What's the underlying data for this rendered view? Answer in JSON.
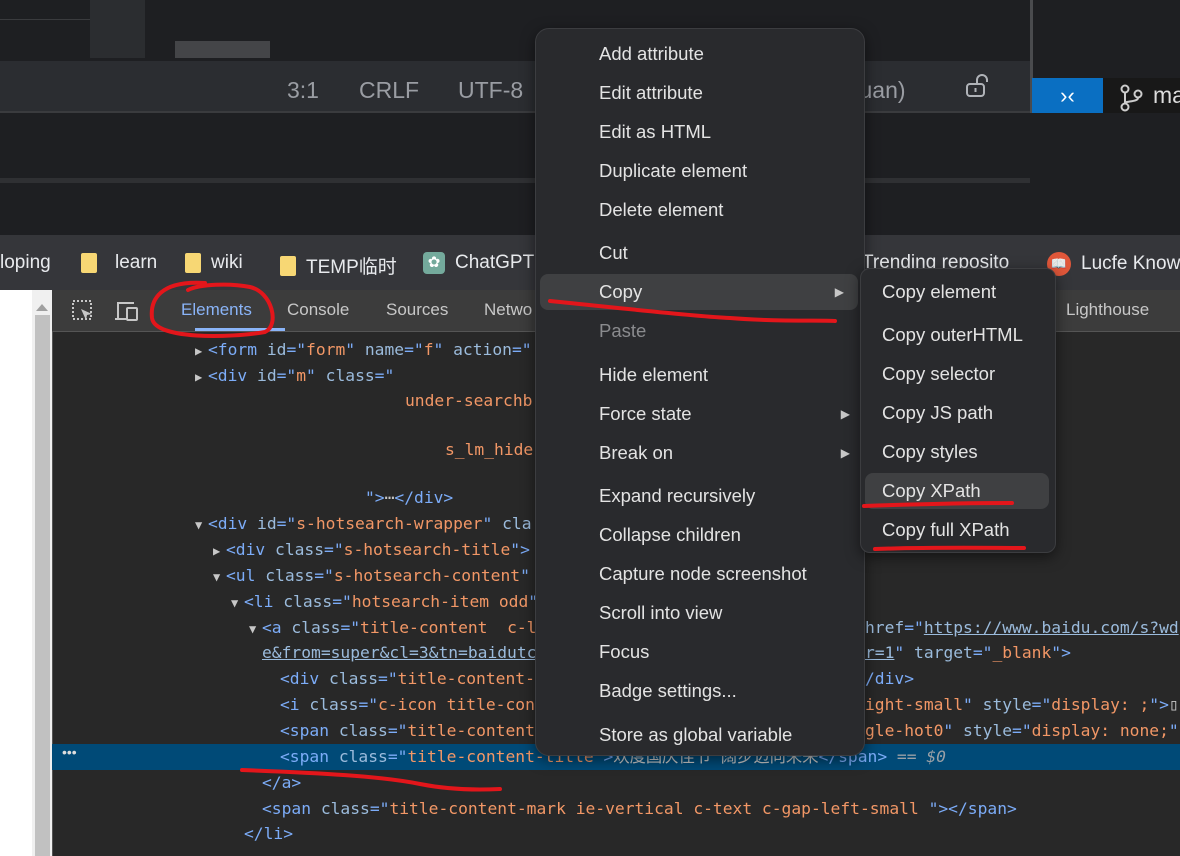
{
  "statusbar": {
    "position": "3:1",
    "line_ending": "CRLF",
    "encoding": "UTF-8",
    "user_partial": "yuan)",
    "branch_partial": "ma"
  },
  "bookmarks": [
    {
      "label": "loping",
      "icon": "none"
    },
    {
      "label": "learn",
      "icon": "folder-icon"
    },
    {
      "label": "wiki",
      "icon": "folder-icon"
    },
    {
      "label": "TEMP临时",
      "icon": "folder-icon"
    },
    {
      "label": "ChatGPT",
      "icon": "chatgpt-icon"
    },
    {
      "label": "Trending reposito",
      "icon": "none"
    },
    {
      "label": "Lucfe Know",
      "icon": "book-icon"
    }
  ],
  "devtools": {
    "tabs": [
      "Elements",
      "Console",
      "Sources",
      "Netwo",
      "Lighthouse"
    ],
    "active_tab": "Elements",
    "selected_suffix": "== $0",
    "code_lines": [
      {
        "indent": 195,
        "tri": "▶",
        "left": [
          [
            "<form ",
            "tag"
          ],
          [
            "id",
            "an"
          ],
          [
            "=\"",
            "tag"
          ],
          [
            "form",
            "av"
          ],
          [
            "\" ",
            "tag"
          ],
          [
            "name",
            "an"
          ],
          [
            "=\"",
            "tag"
          ],
          [
            "f",
            "av"
          ],
          [
            "\" ",
            "tag"
          ],
          [
            "action",
            "an"
          ],
          [
            "=\"",
            "tag"
          ]
        ]
      },
      {
        "indent": 195,
        "tri": "▶",
        "left": [
          [
            "<div ",
            "tag"
          ],
          [
            "id",
            "an"
          ],
          [
            "=\"",
            "tag"
          ],
          [
            "m",
            "av"
          ],
          [
            "\" ",
            "tag"
          ],
          [
            "class",
            "an"
          ],
          [
            "=\"",
            "tag"
          ]
        ]
      },
      {
        "indent": 405,
        "tri": "",
        "left": [
          [
            "under-searchb",
            "av"
          ]
        ]
      },
      {
        "indent": 445,
        "tri": "",
        "left": [
          [
            "s_lm_hide",
            "av"
          ]
        ],
        "gap": true
      },
      {
        "indent": 365,
        "tri": "",
        "left": [
          [
            "\">",
            "tag"
          ],
          [
            "⋯",
            "tx"
          ],
          [
            "</div>",
            "tag"
          ]
        ],
        "gap": true
      },
      {
        "indent": 195,
        "tri": "▼",
        "left": [
          [
            "<div ",
            "tag"
          ],
          [
            "id",
            "an"
          ],
          [
            "=\"",
            "tag"
          ],
          [
            "s-hotsearch-wrapper",
            "av"
          ],
          [
            "\" ",
            "tag"
          ],
          [
            "cla",
            "an"
          ]
        ]
      },
      {
        "indent": 213,
        "tri": "▶",
        "left": [
          [
            "<div ",
            "tag"
          ],
          [
            "class",
            "an"
          ],
          [
            "=\"",
            "tag"
          ],
          [
            "s-hotsearch-title",
            "av"
          ],
          [
            "\">",
            "tag"
          ]
        ]
      },
      {
        "indent": 213,
        "tri": "▼",
        "left": [
          [
            "<ul ",
            "tag"
          ],
          [
            "class",
            "an"
          ],
          [
            "=\"",
            "tag"
          ],
          [
            "s-hotsearch-content",
            "av"
          ],
          [
            "\"",
            "tag"
          ]
        ]
      },
      {
        "indent": 231,
        "tri": "▼",
        "left": [
          [
            "<li ",
            "tag"
          ],
          [
            "class",
            "an"
          ],
          [
            "=\"",
            "tag"
          ],
          [
            "hotsearch-item odd",
            "av"
          ],
          [
            "\"",
            "tag"
          ]
        ]
      },
      {
        "indent": 249,
        "tri": "▼",
        "left": [
          [
            "<a ",
            "tag"
          ],
          [
            "class",
            "an"
          ],
          [
            "=\"",
            "tag"
          ],
          [
            "title-content  c-l",
            "av"
          ]
        ],
        "right": [
          [
            "href",
            "an"
          ],
          [
            "=\"",
            "tag"
          ],
          [
            "https://www.baidu.com/s?wd",
            "lk"
          ]
        ]
      },
      {
        "indent": 262,
        "tri": "",
        "left": [
          [
            "e&from=super&cl=3&tn=baidutc",
            "lk"
          ]
        ],
        "right": [
          [
            "r=1",
            "lk"
          ],
          [
            "\" ",
            "tag"
          ],
          [
            "target",
            "an"
          ],
          [
            "=\"",
            "tag"
          ],
          [
            "_blank",
            "av"
          ],
          [
            "\">",
            "tag"
          ]
        ]
      },
      {
        "indent": 280,
        "tri": "",
        "left": [
          [
            "<div ",
            "tag"
          ],
          [
            "class",
            "an"
          ],
          [
            "=\"",
            "tag"
          ],
          [
            "title-content-",
            "av"
          ]
        ],
        "right": [
          [
            "/div>",
            "tag"
          ]
        ]
      },
      {
        "indent": 280,
        "tri": "",
        "left": [
          [
            "<i ",
            "tag"
          ],
          [
            "class",
            "an"
          ],
          [
            "=\"",
            "tag"
          ],
          [
            "c-icon title-con",
            "av"
          ]
        ],
        "right": [
          [
            "ight-small",
            "av"
          ],
          [
            "\" ",
            "tag"
          ],
          [
            "style",
            "an"
          ],
          [
            "=\"",
            "tag"
          ],
          [
            "display: ;",
            "av"
          ],
          [
            "\">",
            "tag"
          ],
          [
            "▯",
            "tx"
          ]
        ]
      },
      {
        "indent": 280,
        "tri": "",
        "left": [
          [
            "<span ",
            "tag"
          ],
          [
            "class",
            "an"
          ],
          [
            "=\"",
            "tag"
          ],
          [
            "title-content",
            "av"
          ]
        ],
        "right": [
          [
            "gle-hot0",
            "av"
          ],
          [
            "\" ",
            "tag"
          ],
          [
            "style",
            "an"
          ],
          [
            "=\"",
            "tag"
          ],
          [
            "display: none;",
            "av"
          ],
          [
            "\"",
            "tag"
          ]
        ]
      },
      {
        "indent": 280,
        "tri": "",
        "selected": true,
        "left": [
          [
            "<span ",
            "tag"
          ],
          [
            "class",
            "an"
          ],
          [
            "=\"",
            "tag"
          ],
          [
            "title-content-title",
            "av"
          ],
          [
            "\">",
            "tag"
          ],
          [
            "欢度国庆佳节 阔步迈向未来",
            "tx"
          ],
          [
            "</span>",
            "tag"
          ]
        ]
      },
      {
        "indent": 262,
        "tri": "",
        "left": [
          [
            "</a>",
            "tag"
          ]
        ]
      },
      {
        "indent": 262,
        "tri": "",
        "left": [
          [
            "<span ",
            "tag"
          ],
          [
            "class",
            "an"
          ],
          [
            "=\"",
            "tag"
          ],
          [
            "title-content-mark ie-vertical c-text c-gap-left-small ",
            "av"
          ],
          [
            "\"></span>",
            "tag"
          ]
        ]
      },
      {
        "indent": 244,
        "tri": "",
        "left": [
          [
            "</li>",
            "tag"
          ]
        ]
      }
    ]
  },
  "context_menu": {
    "items": [
      {
        "label": "Add attribute"
      },
      {
        "label": "Edit attribute"
      },
      {
        "label": "Edit as HTML"
      },
      {
        "label": "Duplicate element"
      },
      {
        "label": "Delete element"
      },
      {
        "label": "Cut"
      },
      {
        "label": "Copy",
        "submenu": true,
        "highlighted": true
      },
      {
        "label": "Paste",
        "disabled": true
      },
      {
        "label": "Hide element"
      },
      {
        "label": "Force state",
        "submenu": true
      },
      {
        "label": "Break on",
        "submenu": true
      },
      {
        "label": "Expand recursively"
      },
      {
        "label": "Collapse children"
      },
      {
        "label": "Capture node screenshot"
      },
      {
        "label": "Scroll into view"
      },
      {
        "label": "Focus"
      },
      {
        "label": "Badge settings..."
      },
      {
        "label": "Store as global variable"
      }
    ],
    "submenu": [
      {
        "label": "Copy element"
      },
      {
        "label": "Copy outerHTML"
      },
      {
        "label": "Copy selector"
      },
      {
        "label": "Copy JS path"
      },
      {
        "label": "Copy styles"
      },
      {
        "label": "Copy XPath",
        "highlighted": true
      },
      {
        "label": "Copy full XPath"
      }
    ]
  },
  "colors": {
    "annotation": "#e3161b",
    "selection": "#004a77",
    "accent": "#8ab4f8",
    "remote": "#0a6fc2"
  }
}
